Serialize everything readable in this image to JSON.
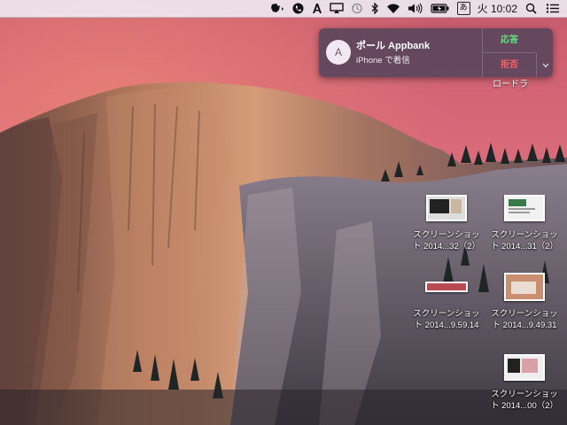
{
  "menubar": {
    "icons": [
      "evernote-icon",
      "phone-icon",
      "script-a-icon",
      "airplay-icon",
      "time-machine-icon",
      "bluetooth-icon",
      "wifi-icon",
      "volume-icon",
      "battery-icon",
      "spotlight-icon",
      "notification-center-icon"
    ],
    "ime_label": "あ",
    "clock": "火 10:02"
  },
  "notification": {
    "avatar_letter": "A",
    "title": "ポール Appbank",
    "subtitle": "iPhone で着信",
    "accept_label": "応答",
    "decline_label": "拒否",
    "accept_color": "#5fe07a",
    "decline_color": "#ff5e66"
  },
  "loader_label": "ロードラ",
  "desktop_icons": [
    {
      "line1": "スクリーンショッ",
      "line2": "ト 2014...32（2）"
    },
    {
      "line1": "スクリーンショッ",
      "line2": "ト 2014...31（2）"
    },
    {
      "line1": "スクリーンショッ",
      "line2": "ト 2014...9.59.14"
    },
    {
      "line1": "スクリーンショッ",
      "line2": "ト 2014...9.49.31"
    },
    {
      "line1": "スクリーンショッ",
      "line2": "ト 2014...00（2）"
    }
  ]
}
